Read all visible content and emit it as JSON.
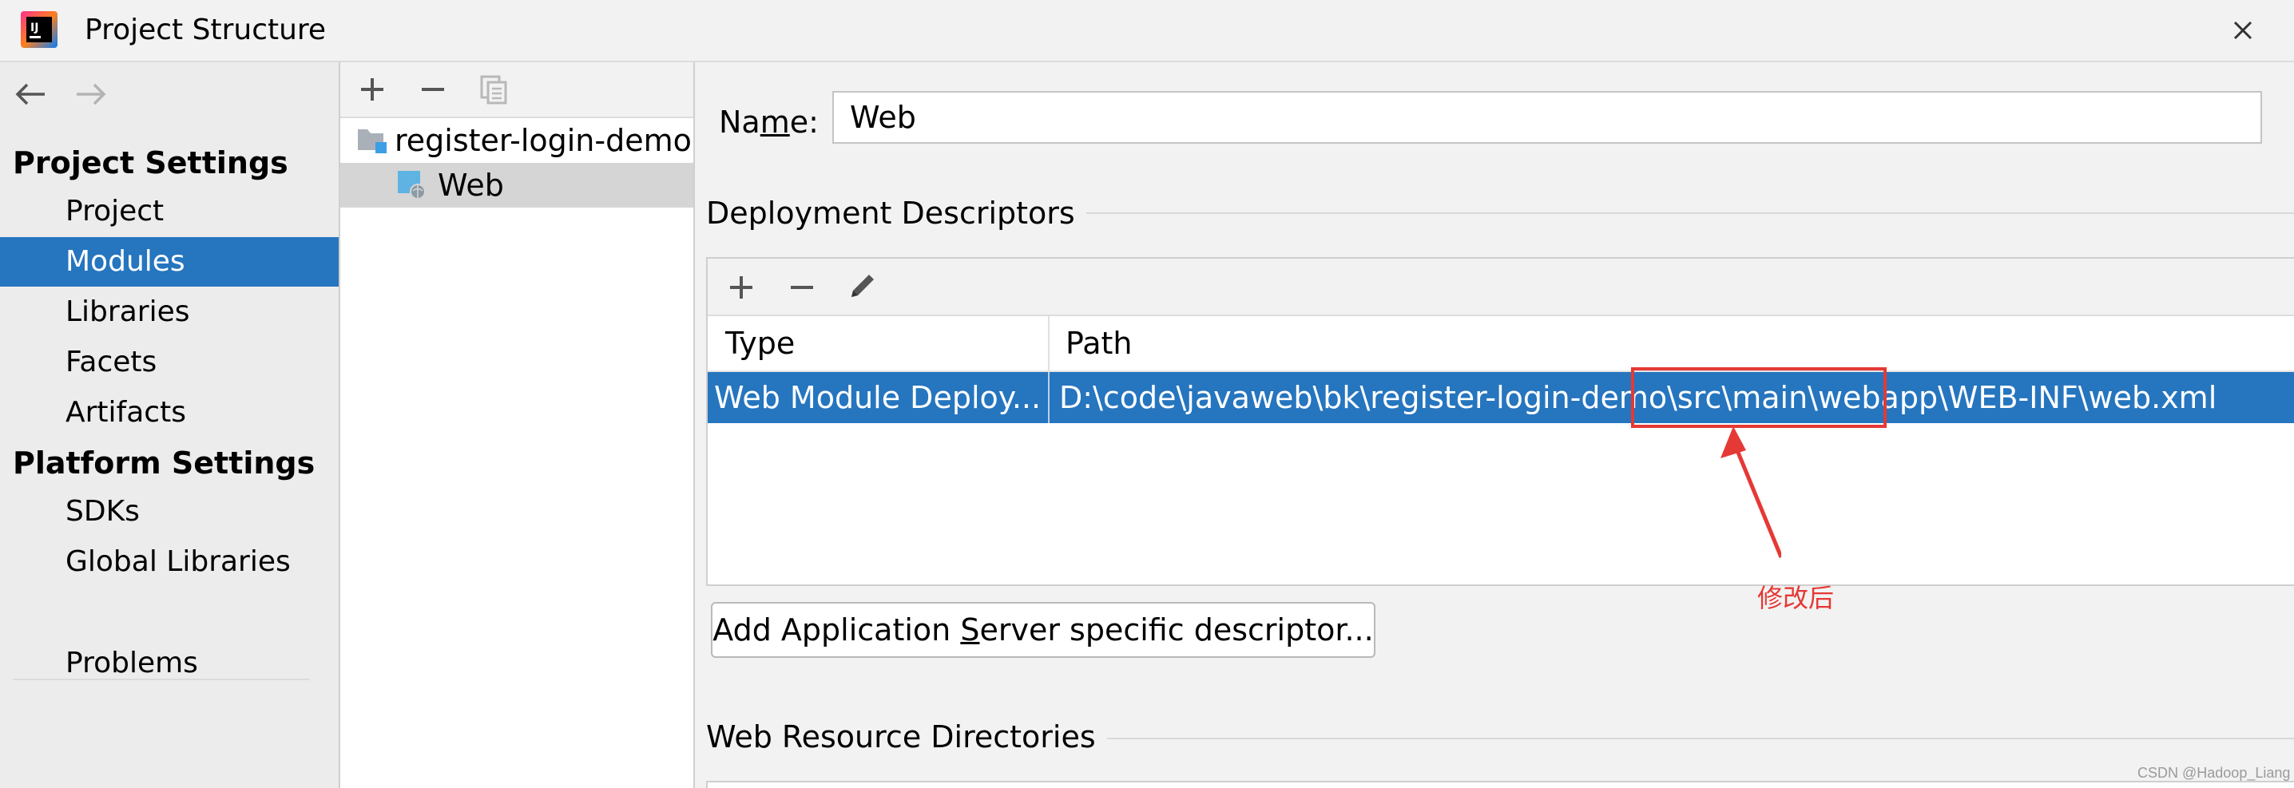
{
  "window": {
    "title": "Project Structure",
    "close_icon": "close-icon",
    "logo_icon": "intellij-logo-icon"
  },
  "nav": {
    "back_icon": "back-arrow-icon",
    "forward_icon": "forward-arrow-icon"
  },
  "sidebar": {
    "project_settings_header": "Project Settings",
    "project_settings_items": [
      {
        "label": "Project"
      },
      {
        "label": "Modules",
        "selected": true
      },
      {
        "label": "Libraries"
      },
      {
        "label": "Facets"
      },
      {
        "label": "Artifacts"
      }
    ],
    "platform_settings_header": "Platform Settings",
    "platform_settings_items": [
      {
        "label": "SDKs"
      },
      {
        "label": "Global Libraries"
      }
    ],
    "problems_label": "Problems"
  },
  "module_tree": {
    "toolbar_icons": [
      "add-icon",
      "remove-icon",
      "copy-icon"
    ],
    "items": [
      {
        "label": "register-login-demo",
        "icon": "module-folder-icon"
      },
      {
        "label": "Web",
        "icon": "web-facet-icon",
        "selected": true
      }
    ]
  },
  "facet": {
    "name_label": "Name:",
    "name_mnemonic": "m",
    "name_value": "Web",
    "deployment_descriptors_title": "Deployment Descriptors",
    "dd_toolbar_icons": [
      "add-icon",
      "remove-icon",
      "edit-pencil-icon"
    ],
    "table": {
      "columns": [
        "Type",
        "Path"
      ],
      "rows": [
        {
          "type": "Web Module Deploy...",
          "path_prefix": "D:\\code\\javaweb\\bk\\register-login-demo",
          "path_highlight": "\\src\\main\\webapp",
          "path_suffix": "\\WEB-INF\\web.xml",
          "selected": true
        }
      ]
    },
    "add_server_descriptor_label": "Add Application Server specific descriptor...",
    "web_resource_directories_title": "Web Resource Directories"
  },
  "annotation": {
    "text": "修改后",
    "color": "#e53935"
  },
  "watermark": "CSDN @Hadoop_Liang",
  "colors": {
    "selection": "#2675bf",
    "annotation_red": "#e53935",
    "background": "#f2f2f2"
  }
}
